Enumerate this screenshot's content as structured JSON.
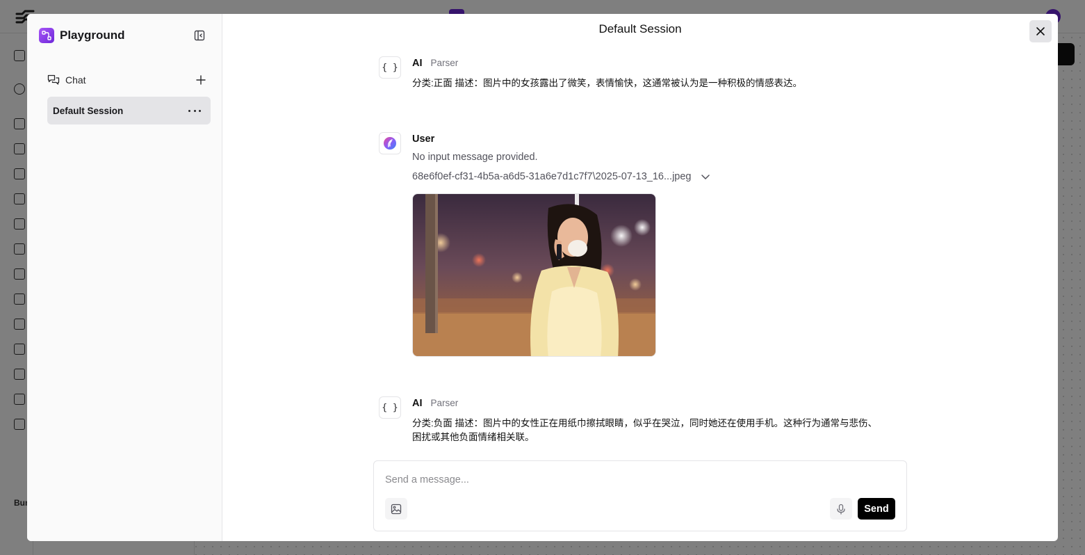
{
  "sidebar": {
    "title": "Playground",
    "chat_label": "Chat",
    "sessions": [
      {
        "label": "Default Session",
        "active": true
      }
    ]
  },
  "main": {
    "title": "Default Session",
    "messages": [
      {
        "sender": "AI",
        "tag": "Parser",
        "avatar": "{ }",
        "text_lines": [
          "分类:正面 描述：图片中的女孩露出了微笑，表情愉快，这通常被认为是一种积极的情感表达。"
        ]
      },
      {
        "sender": "User",
        "avatar_icon": "langflow-user-icon",
        "text": "No input message provided.",
        "file_name": "68e6f0ef-cf31-4b5a-a6d5-31a6e7d1c7f7\\2025-07-13_16...jpeg",
        "image": "photo of a woman in a yellow dress crying on the phone at night"
      },
      {
        "sender": "AI",
        "tag": "Parser",
        "avatar": "{ }",
        "text_lines": [
          "分类:负面 描述：图片中的女性正在用纸巾擦拭眼睛，似乎在哭泣，同时她还在使用手机。这种行为通常与悲伤、",
          "困扰或其他负面情绪相关联。"
        ]
      }
    ]
  },
  "composer": {
    "placeholder": "Send a message...",
    "send_label": "Send"
  },
  "background": {
    "rail_section_label": "Bun"
  },
  "colors": {
    "accent": "#7c3aed",
    "send_button": "#000000",
    "active_session": "#e4e4e7"
  }
}
